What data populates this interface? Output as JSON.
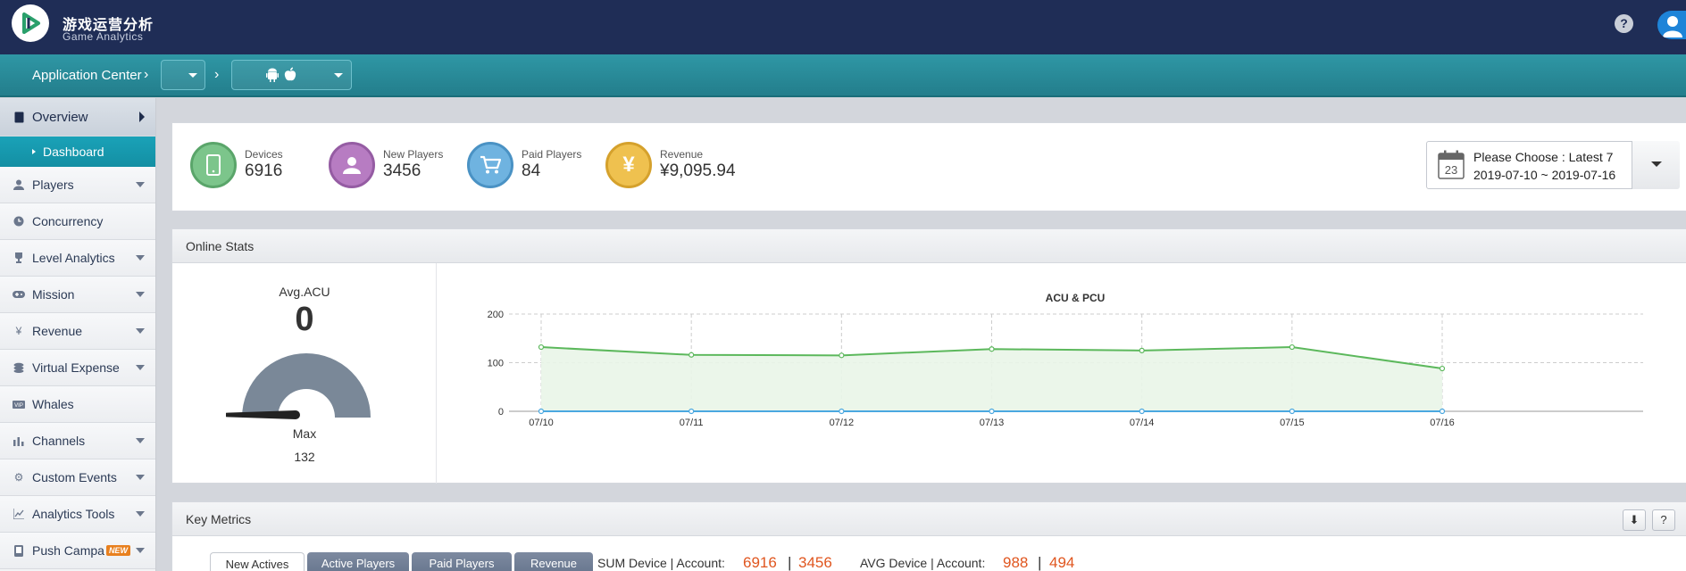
{
  "app": {
    "title_cn": "游戏运营分析",
    "title_en": "Game Analytics",
    "help": "?"
  },
  "nav": {
    "app_center": "Application Center",
    "sep": "›"
  },
  "sidebar": {
    "overview": "Overview",
    "dashboard": "Dashboard",
    "items": [
      {
        "label": "Players",
        "icon": "person-icon",
        "has_arrow": true
      },
      {
        "label": "Concurrency",
        "icon": "clock-icon",
        "has_arrow": false
      },
      {
        "label": "Level Analytics",
        "icon": "trophy-icon",
        "has_arrow": true
      },
      {
        "label": "Mission",
        "icon": "gamepad-icon",
        "has_arrow": true
      },
      {
        "label": "Revenue",
        "icon": "yen-icon",
        "has_arrow": true
      },
      {
        "label": "Virtual Expense",
        "icon": "coins-icon",
        "has_arrow": true
      },
      {
        "label": "Whales",
        "icon": "vip-icon",
        "has_arrow": false
      },
      {
        "label": "Channels",
        "icon": "bar-chart-icon",
        "has_arrow": true
      },
      {
        "label": "Custom Events",
        "icon": "gear-icon",
        "has_arrow": true
      },
      {
        "label": "Analytics Tools",
        "icon": "line-chart-icon",
        "has_arrow": true
      },
      {
        "label": "Push Campa",
        "icon": "phone-icon",
        "has_arrow": true,
        "badge": "NEW"
      }
    ]
  },
  "stats": {
    "devices": {
      "label": "Devices",
      "value": "6916",
      "color": "#6bb77b"
    },
    "new_players": {
      "label": "New Players",
      "value": "3456",
      "color": "#a46bb0"
    },
    "paid_players": {
      "label": "Paid Players",
      "value": "84",
      "color": "#5ca4d6"
    },
    "revenue": {
      "label": "Revenue",
      "value": "¥9,095.94",
      "color": "#e9b53a"
    }
  },
  "date_picker": {
    "line1": "Please Choose : Latest 7",
    "line2": "2019-07-10 ~ 2019-07-16",
    "calendar_day": "23"
  },
  "online_stats": {
    "title": "Online Stats",
    "gauge_title": "Avg.ACU",
    "gauge_value": "0",
    "max_label": "Max",
    "max_value": "132"
  },
  "chart_data": {
    "type": "area",
    "title": "ACU & PCU",
    "categories": [
      "07/10",
      "07/11",
      "07/12",
      "07/13",
      "07/14",
      "07/15",
      "07/16"
    ],
    "ylim": [
      0,
      200
    ],
    "yticks": [
      0,
      100,
      200
    ],
    "grid": true,
    "series": [
      {
        "values": [
          132,
          116,
          115,
          128,
          125,
          132,
          88
        ],
        "color": "#5cb85c"
      },
      {
        "values": [
          0,
          0,
          0,
          0,
          0,
          0,
          0
        ],
        "color": "#4aa8e0"
      }
    ]
  },
  "key_metrics": {
    "title": "Key Metrics",
    "download": "⬇",
    "help": "?",
    "tabs": [
      "New Actives",
      "Active Players",
      "Paid Players",
      "Revenue"
    ],
    "sum_label": "SUM Device | Account:",
    "sum_device": "6916",
    "sum_account": "3456",
    "avg_label": "AVG Device | Account:",
    "avg_device": "988",
    "avg_account": "494",
    "divider": "|"
  }
}
